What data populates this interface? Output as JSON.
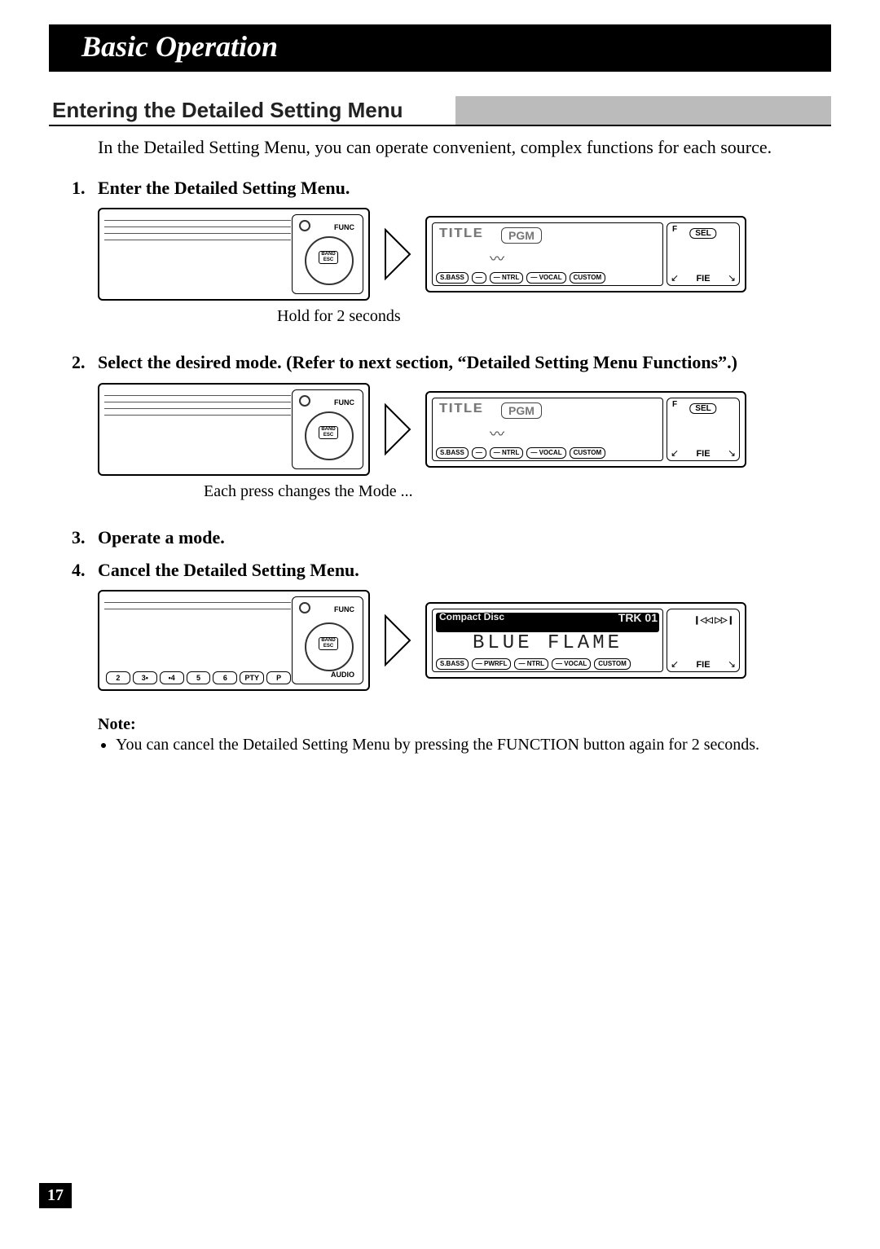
{
  "chapter": "Basic Operation",
  "section_title": "Entering the Detailed Setting Menu",
  "intro": "In the Detailed Setting Menu, you can operate convenient, complex functions for each source.",
  "steps": {
    "s1_num": "1.",
    "s1_text": "Enter the Detailed Setting Menu.",
    "s2_num": "2.",
    "s2_text": "Select the desired mode. (Refer to next section, “Detailed Setting Menu Functions”.)",
    "s3_num": "3.",
    "s3_text": "Operate a mode.",
    "s4_num": "4.",
    "s4_text": "Cancel the Detailed Setting Menu."
  },
  "captions": {
    "c1": "Hold for 2 seconds",
    "c2": "Each press changes the Mode ..."
  },
  "panel": {
    "func": "FUNC",
    "band": "BAND",
    "esc": "ESC",
    "audio": "AUDIO",
    "presets": [
      "2",
      "3•",
      "•4",
      "5",
      "6",
      "PTY",
      "P"
    ]
  },
  "display": {
    "title_label": "TITLE",
    "pgm": "PGM",
    "btns_a": [
      "S.BASS",
      "―",
      "― NTRL",
      "― VOCAL",
      "CUSTOM"
    ],
    "btns_b": [
      "S.BASS",
      "―",
      "― NTRL",
      "― VOCAL",
      "CUSTOM"
    ],
    "btns_c": [
      "S.BASS",
      "― PWRFL",
      "― NTRL",
      "― VOCAL",
      "CUSTOM"
    ],
    "side_f": "F",
    "side_sel": "SEL",
    "side_fie": "FIE",
    "cd_label": "Compact Disc",
    "trk": "TRK 01",
    "big_text": "BLUE FLAME",
    "prev_icon": "❙◁◁",
    "next_icon": "▷▷❙"
  },
  "note": {
    "title": "Note:",
    "item": "You can cancel the Detailed Setting Menu by pressing the FUNCTION button again for 2 seconds."
  },
  "page_number": "17"
}
